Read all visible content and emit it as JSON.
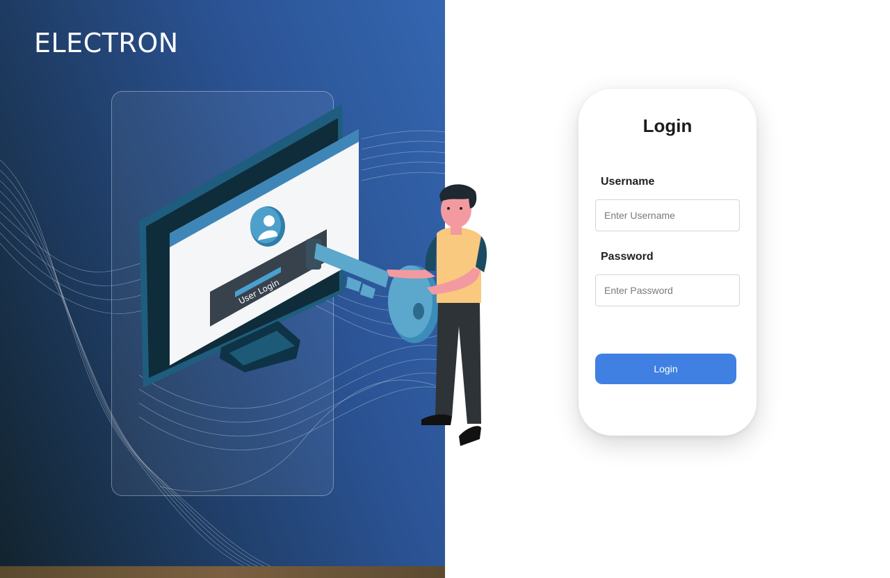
{
  "brand": {
    "title": "ELECTRON"
  },
  "illustration": {
    "screen_label": "User Login"
  },
  "login": {
    "title": "Login",
    "username_label": "Username",
    "username_placeholder": "Enter Username",
    "password_label": "Password",
    "password_placeholder": "Enter Password",
    "button_label": "Login"
  },
  "colors": {
    "left_gradient_start": "#12232d",
    "left_gradient_end": "#3466b0",
    "button": "#3f80e2",
    "card_background": "#ffffff"
  }
}
